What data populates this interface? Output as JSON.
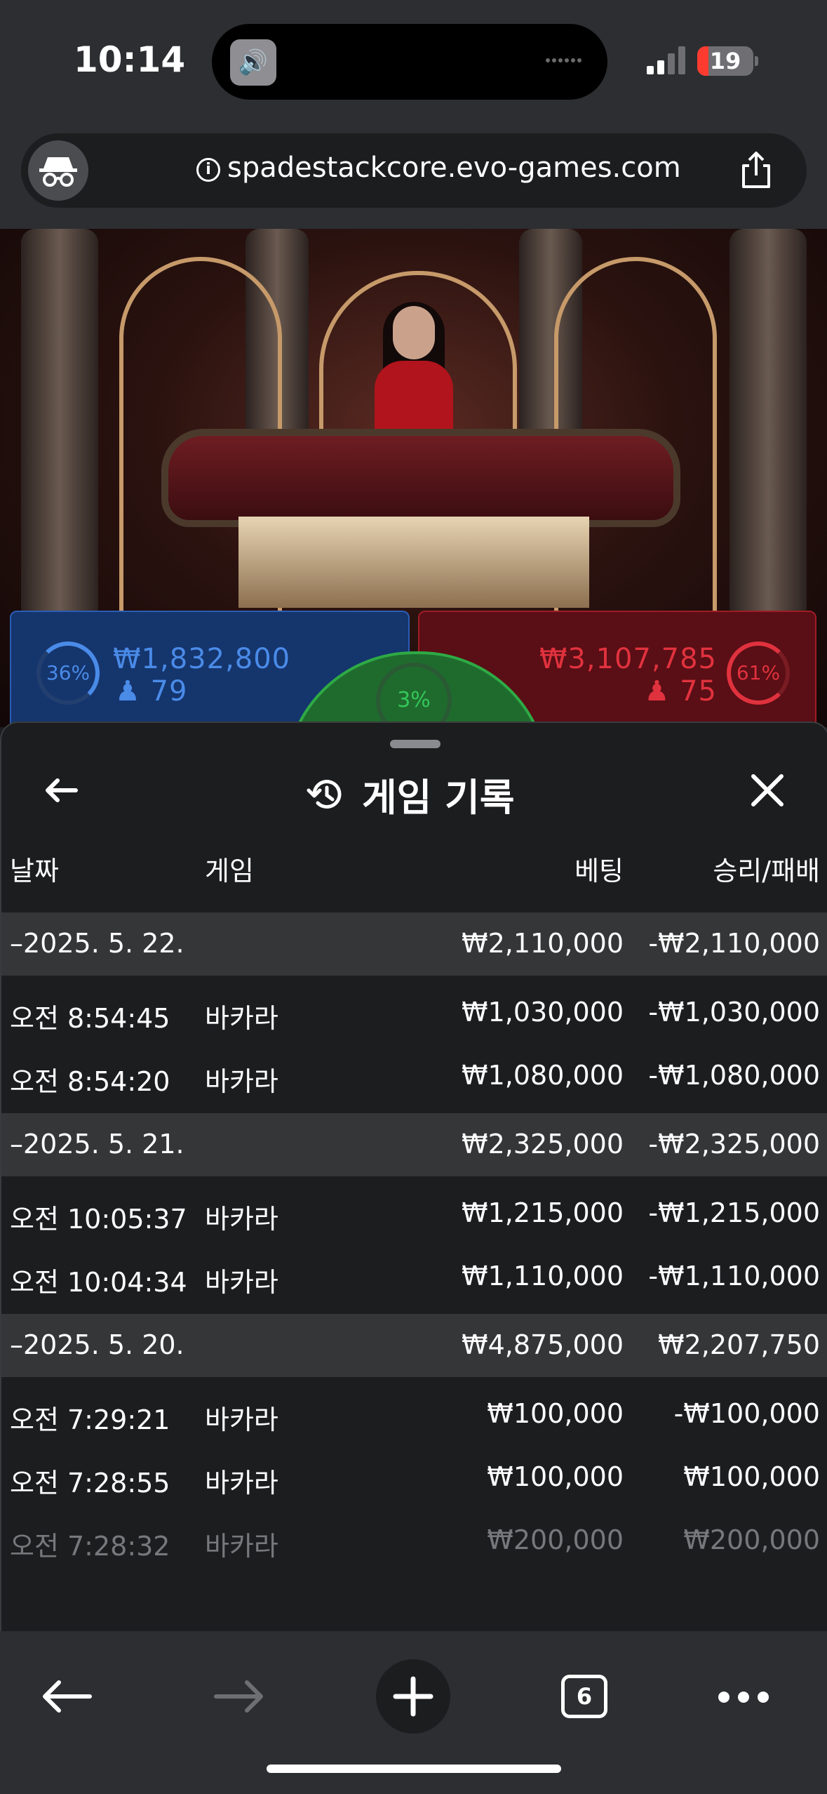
{
  "status_bar": {
    "time": "10:14",
    "battery": "19"
  },
  "browser": {
    "url": "spadestackcore.evo-games.com",
    "tab_count": "6"
  },
  "game": {
    "player": {
      "percent": "36%",
      "amount": "₩1,832,800",
      "players": "79"
    },
    "banker": {
      "percent": "61%",
      "amount": "₩3,107,785",
      "players": "75"
    },
    "tie": {
      "percent": "3%"
    }
  },
  "history": {
    "title": "게임 기록",
    "columns": {
      "date": "날짜",
      "game": "게임",
      "bet": "베팅",
      "win_loss": "승리/패배"
    },
    "groups": [
      {
        "date": "–2025. 5. 22.",
        "bet": "₩2,110,000",
        "win_loss": "-₩2,110,000",
        "rows": [
          {
            "time": "오전 8:54:45",
            "game": "바카라",
            "bet": "₩1,030,000",
            "win_loss": "-₩1,030,000"
          },
          {
            "time": "오전 8:54:20",
            "game": "바카라",
            "bet": "₩1,080,000",
            "win_loss": "-₩1,080,000"
          }
        ]
      },
      {
        "date": "–2025. 5. 21.",
        "bet": "₩2,325,000",
        "win_loss": "-₩2,325,000",
        "rows": [
          {
            "time": "오전 10:05:37",
            "game": "바카라",
            "bet": "₩1,215,000",
            "win_loss": "-₩1,215,000"
          },
          {
            "time": "오전 10:04:34",
            "game": "바카라",
            "bet": "₩1,110,000",
            "win_loss": "-₩1,110,000"
          }
        ]
      },
      {
        "date": "–2025. 5. 20.",
        "bet": "₩4,875,000",
        "win_loss": "₩2,207,750",
        "rows": [
          {
            "time": "오전 7:29:21",
            "game": "바카라",
            "bet": "₩100,000",
            "win_loss": "-₩100,000"
          },
          {
            "time": "오전 7:28:55",
            "game": "바카라",
            "bet": "₩100,000",
            "win_loss": "₩100,000"
          },
          {
            "time": "오전 7:28:32",
            "game": "바카라",
            "bet": "₩200,000",
            "win_loss": "₩200,000"
          }
        ]
      }
    ]
  },
  "icons": {
    "back": "arrow-left-icon",
    "close": "close-icon",
    "history": "history-icon",
    "share": "share-icon",
    "incognito": "incognito-icon",
    "new_tab": "plus-icon",
    "more": "more-icon"
  }
}
